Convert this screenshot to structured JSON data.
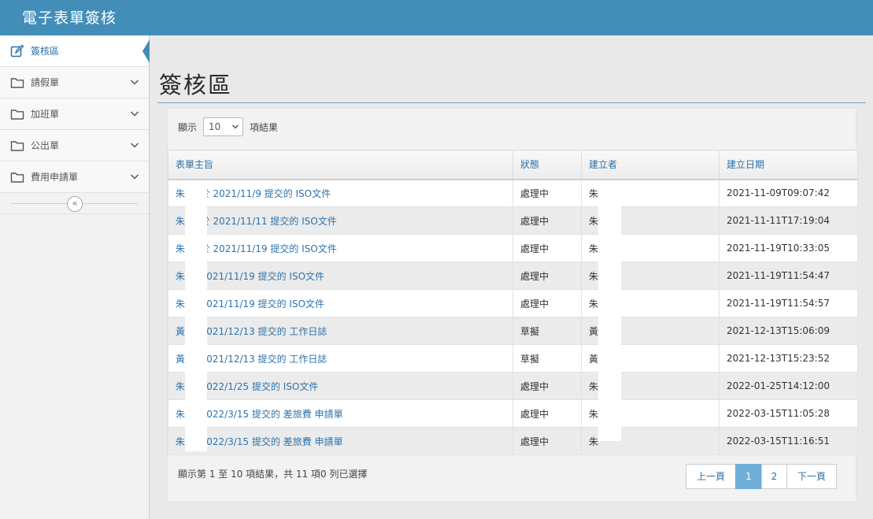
{
  "app": {
    "title": "電子表單簽核"
  },
  "sidebar": {
    "items": [
      {
        "label": "簽核區",
        "icon": "pencil-square-icon",
        "active": true,
        "has_submenu": false
      },
      {
        "label": "請假單",
        "icon": "folder-icon",
        "active": false,
        "has_submenu": true
      },
      {
        "label": "加班單",
        "icon": "folder-icon",
        "active": false,
        "has_submenu": true
      },
      {
        "label": "公出單",
        "icon": "folder-icon",
        "active": false,
        "has_submenu": true
      },
      {
        "label": "費用申請單",
        "icon": "folder-icon",
        "active": false,
        "has_submenu": true
      }
    ],
    "collapse_icon": "double-chevron-left-icon"
  },
  "main": {
    "page_title": "簽核區",
    "length": {
      "prefix": "顯示",
      "value": "10",
      "suffix": "項結果"
    },
    "table": {
      "columns": [
        "表單主旨",
        "狀態",
        "建立者",
        "建立日期"
      ],
      "rows": [
        {
          "subject": "朱 君 於 2021/11/9 提交的 ISO文件",
          "status": "處理中",
          "creator": "朱",
          "date": "2021-11-09T09:07:42"
        },
        {
          "subject": "朱 君 於 2021/11/11 提交的 ISO文件",
          "status": "處理中",
          "creator": "朱",
          "date": "2021-11-11T17:19:04"
        },
        {
          "subject": "朱 君 於 2021/11/19 提交的 ISO文件",
          "status": "處理中",
          "creator": "朱",
          "date": "2021-11-19T10:33:05"
        },
        {
          "subject": "朱 於 2021/11/19 提交的 ISO文件",
          "status": "處理中",
          "creator": "朱",
          "date": "2021-11-19T11:54:47"
        },
        {
          "subject": "朱 於 2021/11/19 提交的 ISO文件",
          "status": "處理中",
          "creator": "朱",
          "date": "2021-11-19T11:54:57"
        },
        {
          "subject": "黃 於 2021/12/13 提交的 工作日誌",
          "status": "草擬",
          "creator": "黃",
          "date": "2021-12-13T15:06:09"
        },
        {
          "subject": "黃 於 2021/12/13 提交的 工作日誌",
          "status": "草擬",
          "creator": "黃",
          "date": "2021-12-13T15:23:52"
        },
        {
          "subject": "朱 於 2022/1/25 提交的 ISO文件",
          "status": "處理中",
          "creator": "朱",
          "date": "2022-01-25T14:12:00"
        },
        {
          "subject": "朱 於 2022/3/15 提交的 差旅費 申請單",
          "status": "處理中",
          "creator": "朱",
          "date": "2022-03-15T11:05:28"
        },
        {
          "subject": "朱 於 2022/3/15 提交的 差旅費 申請單",
          "status": "處理中",
          "creator": "朱",
          "date": "2022-03-15T11:16:51"
        }
      ]
    },
    "info": "顯示第 1 至 10 項結果，共 11 項0 列已選擇",
    "pagination": {
      "prev": "上一頁",
      "pages": [
        "1",
        "2"
      ],
      "current": "1",
      "next": "下一頁"
    }
  },
  "colors": {
    "brand": "#438eb9",
    "link": "#2e73ad",
    "active_page": "#6faed9"
  }
}
